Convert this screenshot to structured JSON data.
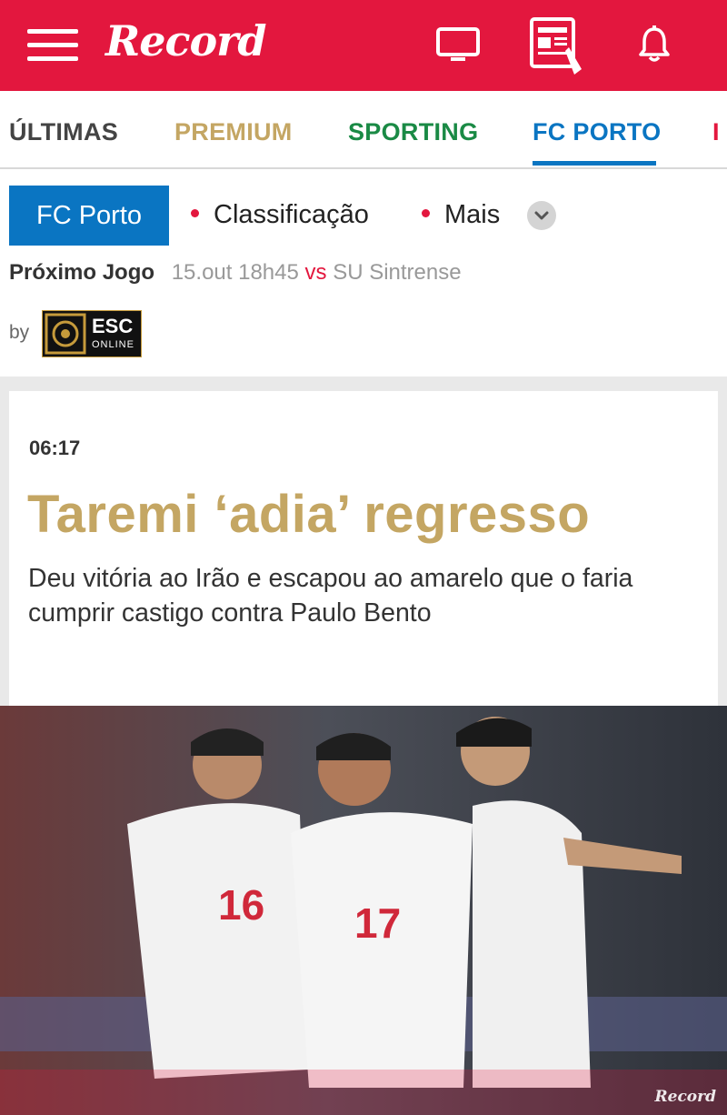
{
  "header": {
    "logo": "Record",
    "icons": [
      "menu-icon",
      "tv-icon",
      "newspaper-icon",
      "bell-icon"
    ],
    "brand_color": "#e3173e"
  },
  "tabs": [
    {
      "label": "ÚLTIMAS",
      "color": "#444444"
    },
    {
      "label": "PREMIUM",
      "color": "#c4a663"
    },
    {
      "label": "SPORTING",
      "color": "#1a8a45"
    },
    {
      "label": "FC PORTO",
      "color": "#0a75c2",
      "active": true
    },
    {
      "label": "I",
      "color": "#e3173e"
    }
  ],
  "team_nav": {
    "team_button": "FC Porto",
    "links": [
      "Classificação",
      "Mais"
    ],
    "more_icon": "chevron-down-icon"
  },
  "next_game": {
    "label": "Próximo Jogo",
    "datetime": "15.out 18h45",
    "vs": "vs",
    "opponent": "SU Sintrense"
  },
  "sponsor": {
    "by_label": "by",
    "name": "ESC",
    "subtitle": "ONLINE"
  },
  "article": {
    "time": "06:17",
    "headline": "Taremi ‘adia’ regresso",
    "lead": "Deu vitória ao Irão e escapou ao amarelo que o faria cumprir castigo contra Paulo Bento",
    "photo": {
      "watermark": "Record",
      "shirt_numbers": [
        "16",
        "17"
      ]
    }
  }
}
